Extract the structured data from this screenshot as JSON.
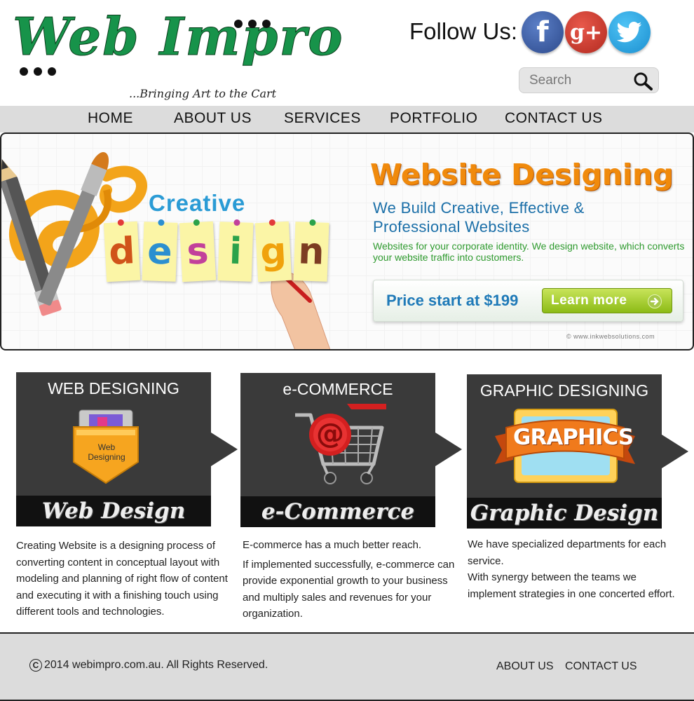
{
  "header": {
    "logo_text": "Web Impro",
    "tagline": "...Bringing Art to the Cart",
    "follow_label": "Follow Us:",
    "social": [
      {
        "name": "facebook-icon",
        "glyph": "f"
      },
      {
        "name": "google-plus-icon",
        "glyph": "g+"
      },
      {
        "name": "twitter-icon"
      }
    ],
    "search": {
      "placeholder": "Search",
      "icon": "search-icon"
    }
  },
  "nav": {
    "items": [
      "HOME",
      "ABOUT US",
      "SERVICES",
      "PORTFOLIO",
      "CONTACT US"
    ]
  },
  "banner": {
    "creative": "Creative",
    "design_letters": [
      "d",
      "e",
      "s",
      "i",
      "g",
      "n"
    ],
    "letter_colors": [
      "#d0531a",
      "#2b8fd0",
      "#c2409b",
      "#2ba24a",
      "#f0a20c",
      "#7c3c22"
    ],
    "title": "Website Designing",
    "subtitle_line1": "We Build Creative, Effective &",
    "subtitle_line2": "Professional Websites",
    "description": "Websites for your corporate identity. We design website, which converts your website traffic into customers.",
    "price": "Price start at $199",
    "cta": "Learn more",
    "credit": "© www.inkwebsolutions.com"
  },
  "services": [
    {
      "title": "WEB DESIGNING",
      "caption": "Web Design",
      "art_label": "Web Designing",
      "text": [
        "Creating Website is a designing process of converting content in conceptual layout with modeling and planning of right flow of content and executing it with a finishing touch using different tools and technologies."
      ]
    },
    {
      "title": "e-COMMERCE",
      "caption": "e-Commerce",
      "text": [
        "E-commerce has a much better reach.",
        "If implemented successfully, e-commerce can provide exponential growth to your business and multiply sales and revenues for your organization."
      ]
    },
    {
      "title": "GRAPHIC DESIGNING",
      "caption": "Graphic Design",
      "art_label": "GRAPHICS",
      "text": [
        "We have specialized departments for each service.",
        "With synergy between the teams we implement strategies in one concerted effort."
      ]
    }
  ],
  "footer": {
    "copyright": "2014 webimpro.com.au. All Rights Reserved.",
    "links": [
      "ABOUT US",
      "CONTACT US"
    ]
  },
  "colors": {
    "logo_green": "#17934a",
    "nav_bg": "#dcdcdc",
    "card_bg": "#3a3a3a",
    "title_orange": "#f08a0c",
    "subtitle_blue": "#1b6fa8",
    "desc_green": "#2e9a2e",
    "cta_green": "#8cbb16"
  }
}
